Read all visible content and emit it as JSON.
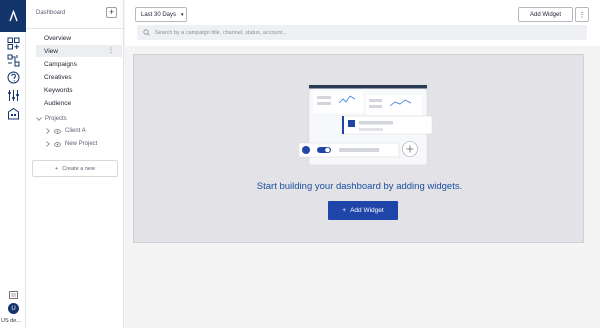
{
  "rail": {
    "logo": "logo-icon",
    "icons": [
      "dashboard-add-icon",
      "connections-icon",
      "help-icon",
      "sliders-icon",
      "building-icon"
    ],
    "bottom_icon": "keyboard-icon",
    "avatar_letter": "U",
    "region_label": "US de..."
  },
  "sidenav": {
    "title": "Dashboard",
    "add_label": "+",
    "items": [
      {
        "label": "Overview"
      },
      {
        "label": "View",
        "active": true,
        "menu": "⋮"
      },
      {
        "label": "Campaigns"
      },
      {
        "label": "Creatives"
      },
      {
        "label": "Keywords"
      },
      {
        "label": "Audience"
      }
    ],
    "projects_label": "Projects",
    "projects": [
      {
        "label": "Client A"
      },
      {
        "label": "New Project"
      }
    ],
    "create_label": "Create a new",
    "create_prefix": "+"
  },
  "toolbar": {
    "date_range": "Last 30 Days",
    "add_widget_label": "Add Widget",
    "more_label": "⋮"
  },
  "search": {
    "placeholder": "Search by a campaign title, channel, status, account..."
  },
  "empty_state": {
    "message": "Start building your dashboard by adding widgets.",
    "button_label": "Add Widget",
    "button_prefix": "+"
  },
  "colors": {
    "brand_navy": "#14356b",
    "primary_button": "#1f45a8",
    "empty_text": "#1a4fa0"
  }
}
